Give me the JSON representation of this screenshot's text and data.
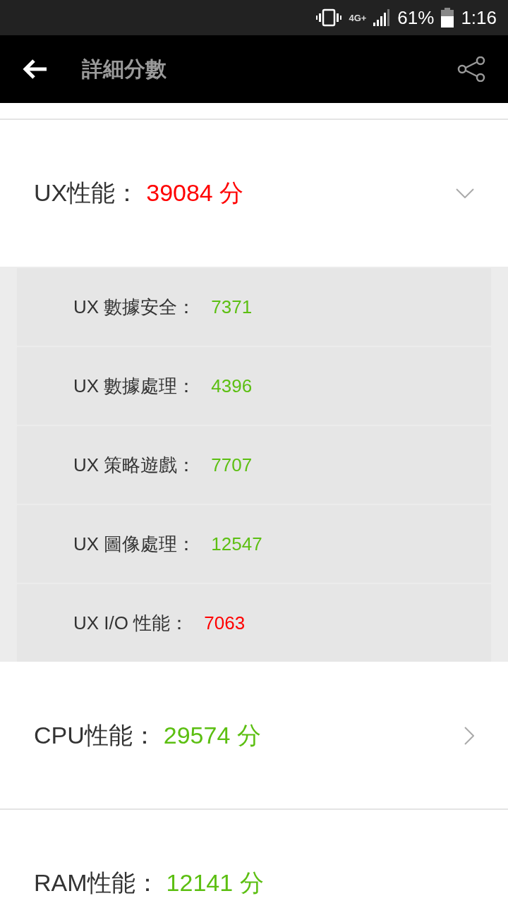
{
  "status_bar": {
    "network": "4G+",
    "battery": "61%",
    "time": "1:16"
  },
  "header": {
    "title": "詳細分數"
  },
  "sections": [
    {
      "label": "UX性能：",
      "score": "39084 分",
      "color": "#ff0000",
      "expanded": true,
      "items": [
        {
          "label": "UX 數據安全：",
          "value": "7371",
          "color": "#5cbf12"
        },
        {
          "label": "UX 數據處理：",
          "value": "4396",
          "color": "#5cbf12"
        },
        {
          "label": "UX 策略遊戲：",
          "value": "7707",
          "color": "#5cbf12"
        },
        {
          "label": "UX 圖像處理：",
          "value": "12547",
          "color": "#5cbf12"
        },
        {
          "label": "UX I/O 性能：",
          "value": "7063",
          "color": "#ff0000"
        }
      ]
    },
    {
      "label": "CPU性能：",
      "score": "29574 分",
      "color": "#5cbf12",
      "expanded": false
    },
    {
      "label": "RAM性能：",
      "score": "12141 分",
      "color": "#5cbf12"
    }
  ]
}
